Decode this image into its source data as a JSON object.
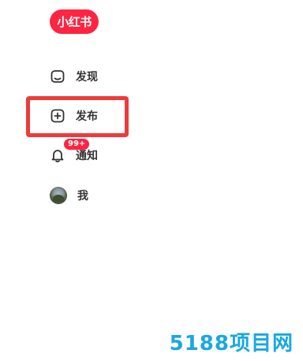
{
  "brand": {
    "logo_text": "小红书",
    "color": "#ff2442"
  },
  "nav": {
    "items": [
      {
        "id": "discover",
        "label": "发现",
        "icon": "home-icon"
      },
      {
        "id": "publish",
        "label": "发布",
        "icon": "plus-square-icon",
        "highlighted": true
      },
      {
        "id": "notify",
        "label": "通知",
        "icon": "bell-icon",
        "badge": "99+"
      },
      {
        "id": "me",
        "label": "我",
        "icon": "avatar"
      }
    ]
  },
  "highlight_color": "#ef3a3a",
  "watermark": {
    "text": "5188项目网",
    "color": "#18a8e0"
  }
}
